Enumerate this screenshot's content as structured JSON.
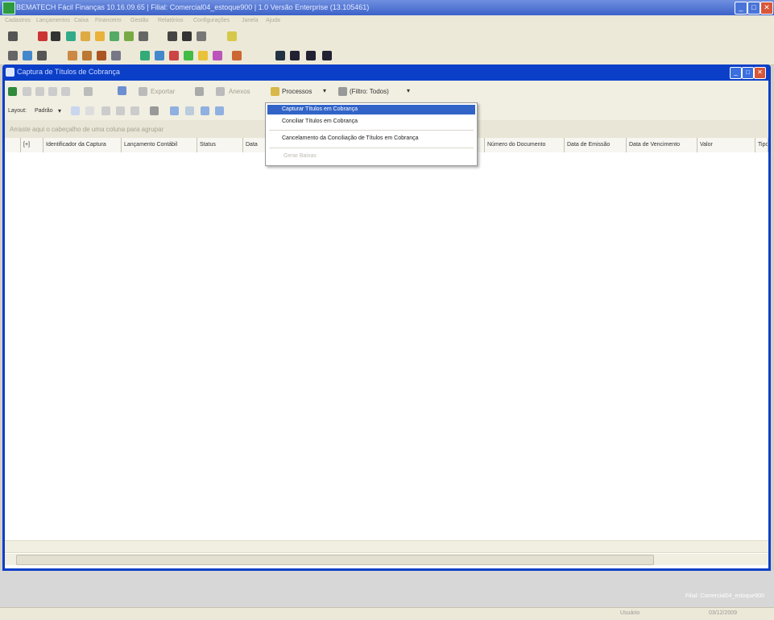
{
  "app": {
    "title": "BEMATECH Fácil Finanças 10.16.09.65 | Filial: Comercial04_estoque900 | 1.0 Versão Enterprise (13.105461)",
    "user_label": "Filial: Comercial04_estoque900"
  },
  "menubar": [
    "Cadastros",
    "Lançamentos",
    "Caixa",
    "Financeiro",
    "Gestão",
    "Relatórios",
    "Configurações",
    "Janela",
    "Ajuda"
  ],
  "window": {
    "title": "Captura de Títulos de Cobrança"
  },
  "toolbar": {
    "exportar_label": "Exportar",
    "anexos_label": "Anexos",
    "processos_label": "Processos",
    "filtro_label": "(Filtro: Todos)"
  },
  "layout_bar": {
    "layout_label": "Layout:",
    "layout_value": "Padrão"
  },
  "group_hint": "Arraste aqui o cabeçalho de uma coluna para agrupar",
  "columns": [
    "[+]",
    "Identificador da Captura",
    "Lançamento Contábil",
    "Status",
    "Data",
    "Número do Documento",
    "Data de Emissão",
    "Data de Vencimento",
    "Valor",
    "Tipo"
  ],
  "process_menu": {
    "items": [
      {
        "label": "Capturar Títulos em Cobrança",
        "selected": true,
        "enabled": true
      },
      {
        "label": "Conciliar Títulos em Cobrança",
        "selected": false,
        "enabled": true
      },
      {
        "label": "Cancelamento da Conciliação de Títulos em Cobrança",
        "selected": false,
        "enabled": true
      },
      {
        "label": "Gerar Baixas",
        "selected": false,
        "enabled": false
      }
    ]
  },
  "statusbar": {
    "left": "Usuário",
    "right": "03/12/2009"
  },
  "colors": {
    "title_blue": "#0b3fc8",
    "menu_highlight": "#3264c8",
    "close_red": "#d8573a"
  }
}
